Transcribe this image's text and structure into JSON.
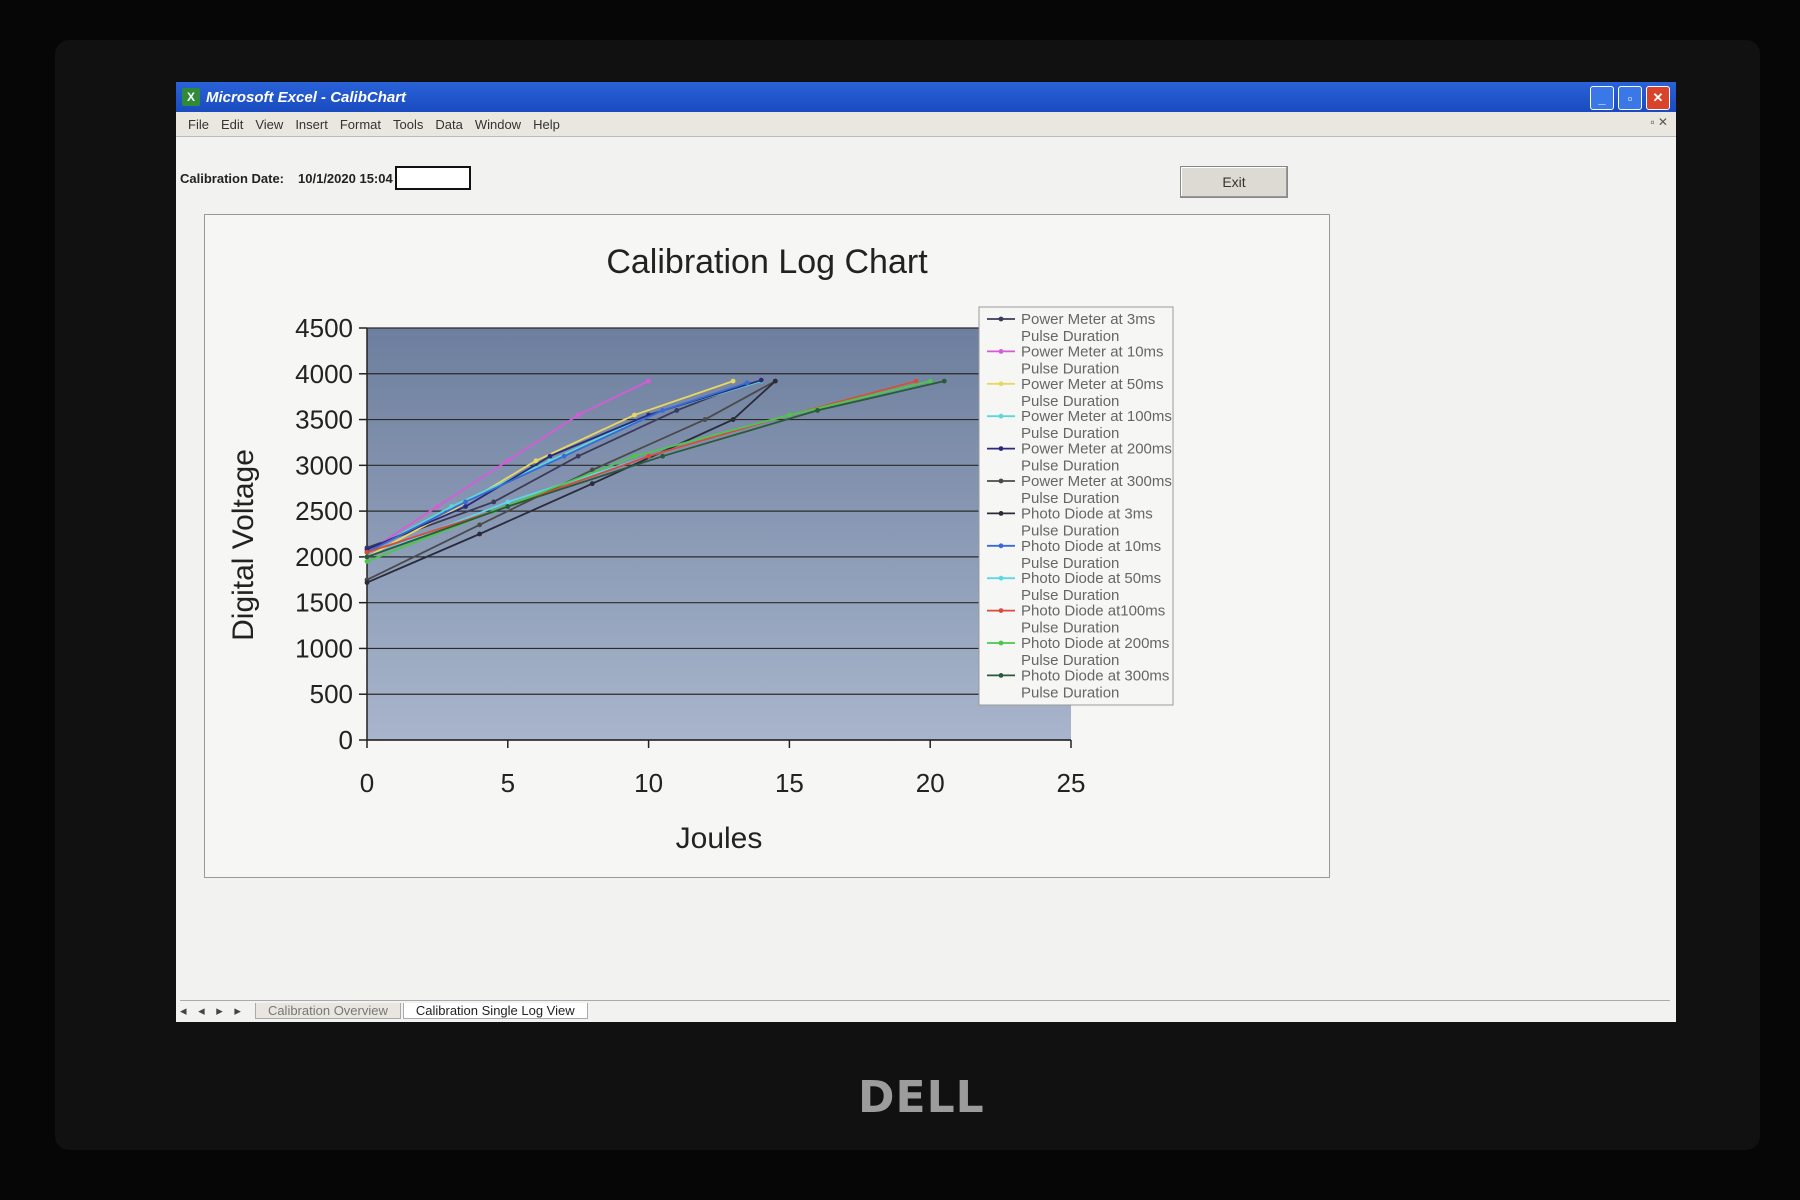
{
  "window": {
    "title": "Microsoft Excel - CalibChart",
    "app_icon": "excel-icon"
  },
  "menu": [
    "File",
    "Edit",
    "View",
    "Insert",
    "Format",
    "Tools",
    "Data",
    "Window",
    "Help"
  ],
  "header": {
    "calibration_label": "Calibration Date:",
    "calibration_value": "10/1/2020 15:04",
    "exit_label": "Exit"
  },
  "tabs": {
    "nav": "◂ ◂ ▸ ▸",
    "items": [
      "Calibration Overview",
      "Calibration Single Log View"
    ],
    "active": 1
  },
  "monitor_brand": "DELL",
  "colors": {
    "plot_bg_top": "#6d7f9e",
    "plot_bg_bottom": "#a8b5cc"
  },
  "chart_data": {
    "type": "line",
    "title": "Calibration Log Chart",
    "xlabel": "Joules",
    "ylabel": "Digital Voltage",
    "xlim": [
      0,
      25
    ],
    "ylim": [
      0,
      4500
    ],
    "xticks": [
      0,
      5,
      10,
      15,
      20,
      25
    ],
    "yticks": [
      0,
      500,
      1000,
      1500,
      2000,
      2500,
      3000,
      3500,
      4000,
      4500
    ],
    "grid": "horizontal",
    "legend_position": "right",
    "series": [
      {
        "name": "Power Meter at 3ms Pulse Duration",
        "color": "#3a3a5a",
        "x": [
          0,
          4.5,
          7.5,
          11,
          13.5
        ],
        "y": [
          2100,
          2600,
          3100,
          3600,
          3900
        ]
      },
      {
        "name": "Power Meter at 10ms Pulse Duration",
        "color": "#d85ad8",
        "x": [
          0,
          2.5,
          5,
          7.5,
          10
        ],
        "y": [
          2050,
          2550,
          3050,
          3550,
          3920
        ]
      },
      {
        "name": "Power Meter at 50ms Pulse Duration",
        "color": "#e8d860",
        "x": [
          0,
          3,
          6,
          9.5,
          13
        ],
        "y": [
          2000,
          2500,
          3050,
          3550,
          3920
        ]
      },
      {
        "name": "Power Meter at 100ms Pulse Duration",
        "color": "#5ad8d8",
        "x": [
          0,
          3,
          6.5,
          10,
          14
        ],
        "y": [
          2050,
          2550,
          3050,
          3550,
          3920
        ]
      },
      {
        "name": "Power Meter at 200ms Pulse Duration",
        "color": "#2a2a7a",
        "x": [
          0,
          3.5,
          6.5,
          10,
          14
        ],
        "y": [
          2080,
          2550,
          3100,
          3550,
          3930
        ]
      },
      {
        "name": "Power Meter at 300ms Pulse Duration",
        "color": "#4a4a4a",
        "x": [
          0,
          4,
          8,
          12,
          14.5
        ],
        "y": [
          1750,
          2350,
          2950,
          3500,
          3920
        ]
      },
      {
        "name": "Photo Diode at 3ms Pulse Duration",
        "color": "#2a2a3a",
        "x": [
          0,
          4,
          8,
          13,
          14.5
        ],
        "y": [
          1720,
          2250,
          2800,
          3500,
          3920
        ]
      },
      {
        "name": "Photo Diode at 10ms Pulse Duration",
        "color": "#3a6ad8",
        "x": [
          0,
          3.5,
          7,
          10.5,
          13.5
        ],
        "y": [
          2050,
          2600,
          3100,
          3600,
          3900
        ]
      },
      {
        "name": "Photo Diode at 50ms Pulse Duration",
        "color": "#5ad8e8",
        "x": [
          0,
          5,
          10,
          15,
          19.5
        ],
        "y": [
          2000,
          2600,
          3100,
          3550,
          3920
        ]
      },
      {
        "name": "Photo Diode at100ms Pulse Duration",
        "color": "#d84a3a",
        "x": [
          0,
          5,
          10,
          15,
          19.5
        ],
        "y": [
          2050,
          2550,
          3100,
          3550,
          3920
        ]
      },
      {
        "name": "Photo Diode at 200ms Pulse Duration",
        "color": "#4ac84a",
        "x": [
          0,
          4.5,
          9.5,
          15,
          20
        ],
        "y": [
          1950,
          2500,
          3100,
          3550,
          3920
        ]
      },
      {
        "name": "Photo Diode at 300ms Pulse Duration",
        "color": "#2a5a3a",
        "x": [
          0,
          5,
          10.5,
          16,
          20.5
        ],
        "y": [
          2000,
          2550,
          3100,
          3600,
          3920
        ]
      }
    ]
  }
}
